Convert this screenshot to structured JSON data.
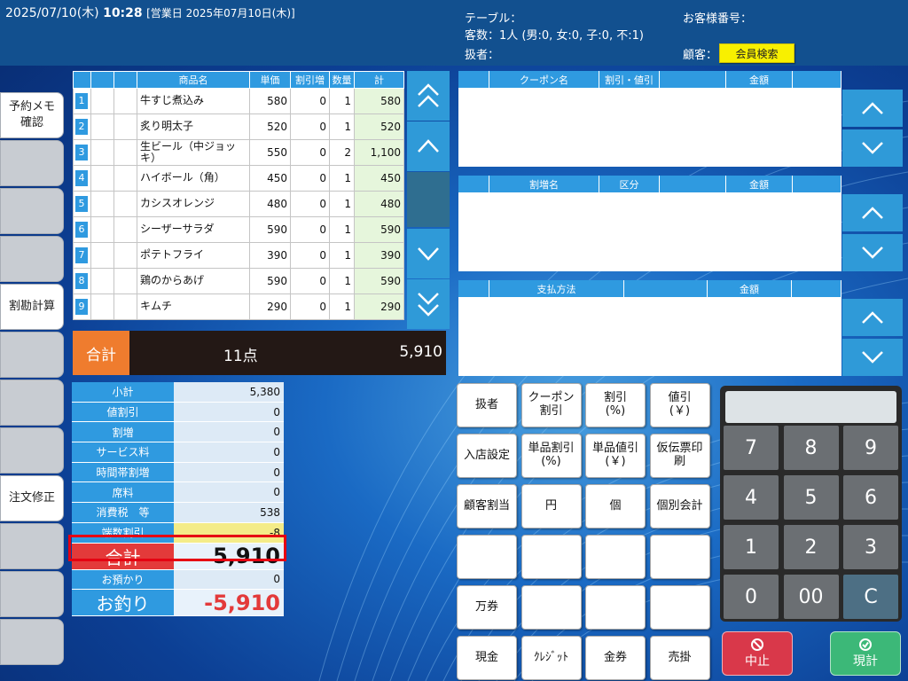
{
  "header": {
    "datetime": "2025/07/10(木)",
    "time": "10:28",
    "business_day": "[営業日 2025年07月10日(木)]",
    "table_label": "テーブル：",
    "guests": "客数：1人 (男:0, 女:0, 子:0, 不:1)",
    "staff_label": "扱者：",
    "customer_no_label": "お客様番号：",
    "customer_label": "顧客：",
    "member_search": "会員検索"
  },
  "side_buttons": [
    "予約メモ\n確認",
    "",
    "",
    "",
    "割勘計算",
    "",
    "",
    "",
    "注文修正",
    "",
    "",
    ""
  ],
  "items_table": {
    "headers": [
      "",
      "",
      "",
      "商品名",
      "単価",
      "割引増",
      "数量",
      "計"
    ],
    "rows": [
      {
        "no": "1",
        "name": "牛すじ煮込み",
        "price": "580",
        "disc": "0",
        "qty": "1",
        "total": "580"
      },
      {
        "no": "2",
        "name": "炙り明太子",
        "price": "520",
        "disc": "0",
        "qty": "1",
        "total": "520"
      },
      {
        "no": "3",
        "name": "生ビール（中ジョッキ）",
        "price": "550",
        "disc": "0",
        "qty": "2",
        "total": "1,100"
      },
      {
        "no": "4",
        "name": "ハイボール（角）",
        "price": "450",
        "disc": "0",
        "qty": "1",
        "total": "450"
      },
      {
        "no": "5",
        "name": "カシスオレンジ",
        "price": "480",
        "disc": "0",
        "qty": "1",
        "total": "480"
      },
      {
        "no": "6",
        "name": "シーザーサラダ",
        "price": "590",
        "disc": "0",
        "qty": "1",
        "total": "590"
      },
      {
        "no": "7",
        "name": "ポテトフライ",
        "price": "390",
        "disc": "0",
        "qty": "1",
        "total": "390"
      },
      {
        "no": "8",
        "name": "鶏のからあげ",
        "price": "590",
        "disc": "0",
        "qty": "1",
        "total": "590"
      },
      {
        "no": "9",
        "name": "キムチ",
        "price": "290",
        "disc": "0",
        "qty": "1",
        "total": "290"
      }
    ]
  },
  "total_bar": {
    "label": "合計",
    "count": "11点",
    "amount": "5,910"
  },
  "summary": {
    "rows": [
      {
        "k": "小計",
        "v": "5,380"
      },
      {
        "k": "値割引",
        "v": "0"
      },
      {
        "k": "割増",
        "v": "0"
      },
      {
        "k": "サービス料",
        "v": "0"
      },
      {
        "k": "時間帯割増",
        "v": "0"
      },
      {
        "k": "席料",
        "v": "0"
      },
      {
        "k": "消費税　等",
        "v": "538"
      },
      {
        "k": "端数割引",
        "v": "-8"
      }
    ],
    "total_label": "合計",
    "total": "5,910",
    "deposit_label": "お預かり",
    "deposit": "0",
    "change_label": "お釣り",
    "change": "-5,910"
  },
  "coupon_panel": {
    "headers": [
      "",
      "クーポン名",
      "割引・値引",
      "",
      "金額",
      ""
    ]
  },
  "surcharge_panel": {
    "headers": [
      "",
      "割増名",
      "区分",
      "",
      "金額",
      ""
    ]
  },
  "payment_panel": {
    "headers": [
      "",
      "支払方法",
      "",
      "金額",
      ""
    ]
  },
  "function_keys": [
    "扱者",
    "クーポン\n割引",
    "割引\n(%)",
    "値引\n(￥)",
    "入店設定",
    "単品割引\n(%)",
    "単品値引\n(￥)",
    "仮伝票印\n刷",
    "顧客割当",
    "円",
    "個",
    "個別会計",
    "",
    "",
    "",
    "",
    "万券",
    "",
    "",
    "",
    "現金",
    "ｸﾚｼﾞｯﾄ",
    "金券",
    "売掛"
  ],
  "keypad": [
    "7",
    "8",
    "9",
    "4",
    "5",
    "6",
    "1",
    "2",
    "3",
    "0",
    "00",
    "C"
  ],
  "actions": {
    "cancel": "中止",
    "checkout": "現計"
  },
  "colors": {
    "header": "#12508f",
    "accent": "#2f9ae0",
    "orange": "#ef7c2e",
    "red": "#e33a3a",
    "green": "#3cb878"
  }
}
